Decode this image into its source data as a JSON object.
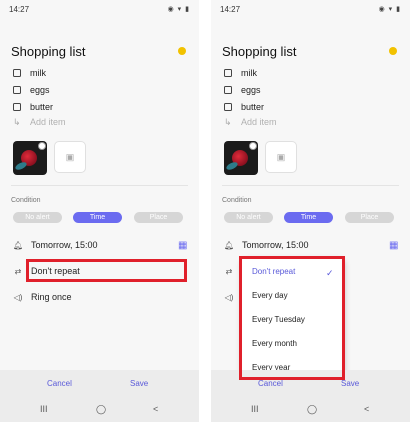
{
  "status_bar": {
    "time": "14:27",
    "icons": "◉ ▾ ▮"
  },
  "note": {
    "title": "Shopping list",
    "accent_color": "#f2c200",
    "items": [
      "milk",
      "eggs",
      "butter"
    ],
    "add_item_placeholder": "Add item"
  },
  "condition": {
    "label": "Condition",
    "options": [
      "No alert",
      "Time",
      "Place"
    ],
    "selected": "Time"
  },
  "reminder": {
    "date_time": "Tomorrow, 15:00",
    "repeat": "Don't repeat",
    "sound": "Ring once"
  },
  "repeat_menu": {
    "options": [
      "Don't repeat",
      "Every day",
      "Every Tuesday",
      "Every month",
      "Every year"
    ],
    "selected": "Don't repeat"
  },
  "actions": {
    "cancel": "Cancel",
    "save": "Save"
  },
  "nav_bar": {
    "recents": "III",
    "home": "◯",
    "back": "<"
  },
  "colors": {
    "accent": "#6b6bf0",
    "highlight": "#e0202b"
  }
}
